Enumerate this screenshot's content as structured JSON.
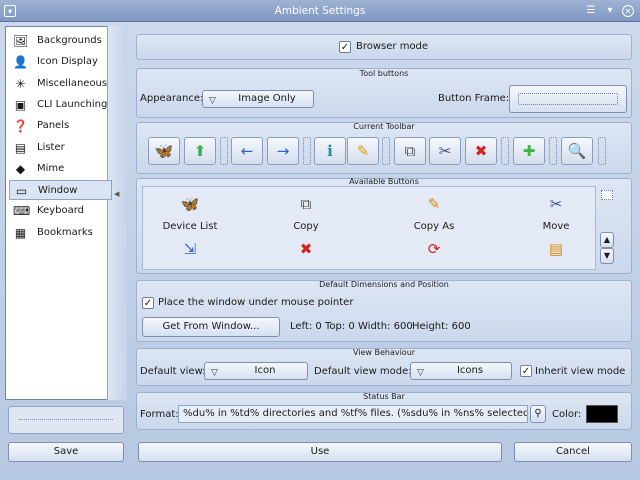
{
  "window": {
    "title": "Ambient Settings",
    "controls": [
      "menu",
      "minimize",
      "close"
    ]
  },
  "sidebar": {
    "items": [
      {
        "label": "Backgrounds",
        "icon": "backgrounds-icon",
        "glyph": "🖼"
      },
      {
        "label": "Icon Display",
        "icon": "icon-display-icon",
        "glyph": "👤"
      },
      {
        "label": "Miscellaneous",
        "icon": "miscellaneous-icon",
        "glyph": "✳"
      },
      {
        "label": "CLI Launching",
        "icon": "terminal-icon",
        "glyph": "▣"
      },
      {
        "label": "Panels",
        "icon": "panels-icon",
        "glyph": "❓"
      },
      {
        "label": "Lister",
        "icon": "lister-icon",
        "glyph": "▤"
      },
      {
        "label": "Mime",
        "icon": "mime-icon",
        "glyph": "◆"
      },
      {
        "label": "Window",
        "icon": "window-icon",
        "glyph": "▭",
        "selected": true
      },
      {
        "label": "Keyboard",
        "icon": "keyboard-icon",
        "glyph": "⌨"
      },
      {
        "label": "Bookmarks",
        "icon": "bookmarks-icon",
        "glyph": "▦"
      }
    ]
  },
  "browser_mode": {
    "label": "Browser mode",
    "checked": true
  },
  "tool_buttons": {
    "title": "Tool buttons",
    "appearance_label": "Appearance:",
    "appearance_value": "Image Only",
    "button_frame_label": "Button Frame:"
  },
  "current_toolbar": {
    "title": "Current Toolbar",
    "buttons": [
      {
        "icon": "butterfly-icon",
        "glyph": "🦋",
        "color": "#2b8be0"
      },
      {
        "icon": "arrow-up-icon",
        "glyph": "⬆",
        "color": "#2fb34a"
      },
      {
        "icon": "arrow-left-icon",
        "glyph": "←",
        "color": "#2f62c8"
      },
      {
        "icon": "arrow-right-icon",
        "glyph": "→",
        "color": "#2f62c8"
      },
      {
        "icon": "info-icon",
        "glyph": "ℹ",
        "color": "#1f8a9e"
      },
      {
        "icon": "rename-icon",
        "glyph": "✎",
        "color": "#e09a12"
      },
      {
        "icon": "copy-icon",
        "glyph": "⧉",
        "color": "#555555"
      },
      {
        "icon": "move-icon",
        "glyph": "✂",
        "color": "#3a4f8c"
      },
      {
        "icon": "delete-icon",
        "glyph": "✖",
        "color": "#d42222"
      },
      {
        "icon": "add-icon",
        "glyph": "✚",
        "color": "#3fb83f"
      },
      {
        "icon": "find-icon",
        "glyph": "🔍",
        "color": "#333333"
      }
    ]
  },
  "available_buttons": {
    "title": "Available Buttons",
    "items": [
      {
        "label": "Device List",
        "icon": "butterfly-icon",
        "glyph": "🦋",
        "color": "#2b8be0"
      },
      {
        "label": "Copy",
        "icon": "copy-icon",
        "glyph": "⧉",
        "color": "#555555"
      },
      {
        "label": "Copy As",
        "icon": "copy-as-icon",
        "glyph": "✎",
        "color": "#d88a10"
      },
      {
        "label": "Move",
        "icon": "move-icon",
        "glyph": "✂",
        "color": "#3a4f8c"
      }
    ],
    "row2": [
      {
        "icon": "move-as-icon",
        "glyph": "⇲",
        "color": "#2f62c8"
      },
      {
        "icon": "delete-icon",
        "glyph": "✖",
        "color": "#d42222"
      },
      {
        "icon": "reload-icon",
        "glyph": "⟳",
        "color": "#d42222"
      },
      {
        "icon": "archive-icon",
        "glyph": "▤",
        "color": "#d88a10"
      }
    ]
  },
  "dimensions": {
    "title": "Default Dimensions and Position",
    "place_label": "Place the window under mouse pointer",
    "place_checked": true,
    "get_button": "Get From Window...",
    "left": "Left: 0",
    "top": "Top: 0",
    "width": "Width: 600",
    "height": "Height: 600"
  },
  "view_behaviour": {
    "title": "View Behaviour",
    "default_view_label": "Default view:",
    "default_view_value": "Icon",
    "default_mode_label": "Default view mode:",
    "default_mode_value": "Icons",
    "inherit_label": "Inherit view mode",
    "inherit_checked": true
  },
  "status_bar": {
    "title": "Status Bar",
    "format_label": "Format:",
    "format_value": "%du% in %td% directories and %tf% files. (%sdu% in %ns% selected).",
    "color_label": "Color:",
    "color_value": "#000000"
  },
  "footer": {
    "save": "Save",
    "use": "Use",
    "cancel": "Cancel"
  }
}
